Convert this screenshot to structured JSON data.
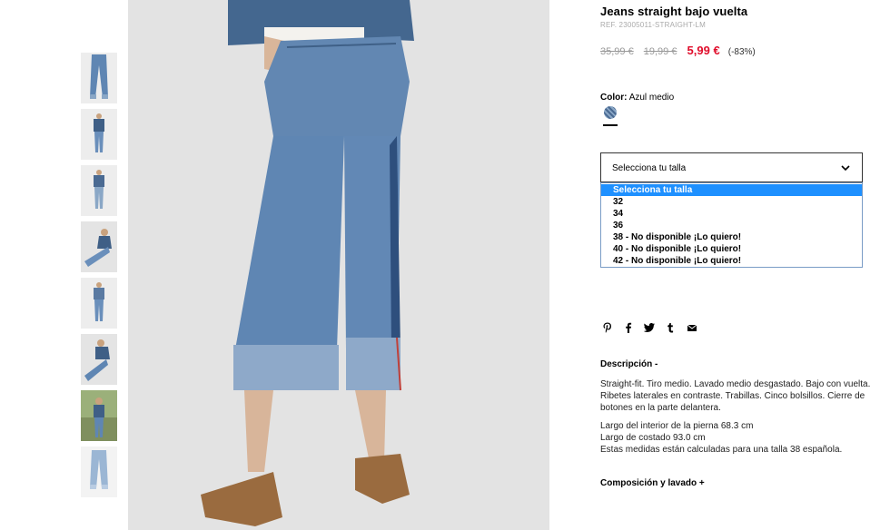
{
  "thumbnails": [
    {
      "icon": "jeans-front-thumb"
    },
    {
      "icon": "model-full-thumb"
    },
    {
      "icon": "model-full-thumb-2"
    },
    {
      "icon": "model-sitting-thumb"
    },
    {
      "icon": "model-full-thumb-3"
    },
    {
      "icon": "model-sitting-thumb-2"
    },
    {
      "icon": "model-outdoor-thumb"
    },
    {
      "icon": "jeans-flat-thumb"
    }
  ],
  "product": {
    "title": "Jeans straight bajo vuelta",
    "ref": "REF. 23005011-STRAIGHT-LM",
    "price_original": "35,99 €",
    "price_previous": "19,99 €",
    "price_current": "5,99 €",
    "discount": "(-83%)",
    "color_label": "Color:",
    "color_value": "Azul medio"
  },
  "size_select": {
    "label": "Selecciona tu talla",
    "options": [
      "Selecciona tu talla",
      "32",
      "34",
      "36",
      "38 - No disponible ¡Lo quiero!",
      "40 - No disponible ¡Lo quiero!",
      "42 - No disponible ¡Lo quiero!"
    ]
  },
  "social": [
    "pinterest-icon",
    "facebook-icon",
    "twitter-icon",
    "tumblr-icon",
    "email-icon"
  ],
  "description": {
    "heading": "Descripción -",
    "paragraph": "Straight-fit. Tiro medio. Lavado medio desgastado. Bajo con vuelta. Ribetes laterales en contraste. Trabillas. Cinco bolsillos. Cierre de botones en la parte delantera.",
    "measure_1": "Largo del interior de la pierna 68.3 cm",
    "measure_2": "Largo de costado 93.0 cm",
    "measure_3": "Estas medidas están calculadas para una talla 38 española."
  },
  "composition": {
    "heading": "Composición y lavado +"
  },
  "colors": {
    "price_current": "#e00d2b",
    "selected_option": "#1e90ff",
    "denim": "#5f86b3"
  }
}
